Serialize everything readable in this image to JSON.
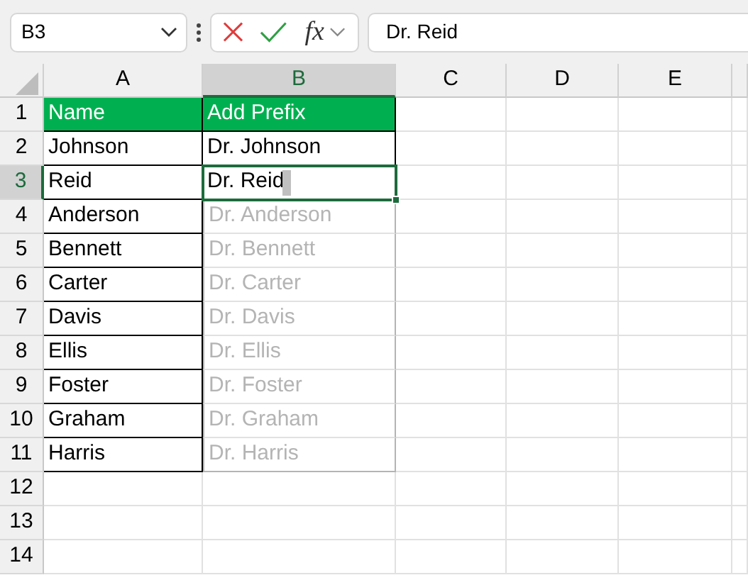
{
  "name_box": {
    "value": "B3"
  },
  "formula_bar": {
    "function_label": "fx",
    "value": "Dr. Reid"
  },
  "columns": [
    {
      "label": "A",
      "selected": false
    },
    {
      "label": "B",
      "selected": true
    },
    {
      "label": "C",
      "selected": false
    },
    {
      "label": "D",
      "selected": false
    },
    {
      "label": "E",
      "selected": false
    }
  ],
  "rows": [
    {
      "label": "1",
      "selected": false,
      "cells": [
        {
          "text": "Name",
          "kind": "header"
        },
        {
          "text": "Add Prefix",
          "kind": "header"
        }
      ]
    },
    {
      "label": "2",
      "selected": false,
      "cells": [
        {
          "text": "Johnson",
          "kind": "value"
        },
        {
          "text": "Dr. Johnson",
          "kind": "value"
        }
      ]
    },
    {
      "label": "3",
      "selected": true,
      "cells": [
        {
          "text": "Reid",
          "kind": "value"
        },
        {
          "text": "Dr. Reid",
          "kind": "active"
        }
      ]
    },
    {
      "label": "4",
      "selected": false,
      "cells": [
        {
          "text": "Anderson",
          "kind": "value"
        },
        {
          "text": "Dr. Anderson",
          "kind": "suggestion"
        }
      ]
    },
    {
      "label": "5",
      "selected": false,
      "cells": [
        {
          "text": "Bennett",
          "kind": "value"
        },
        {
          "text": "Dr. Bennett",
          "kind": "suggestion"
        }
      ]
    },
    {
      "label": "6",
      "selected": false,
      "cells": [
        {
          "text": "Carter",
          "kind": "value"
        },
        {
          "text": "Dr. Carter",
          "kind": "suggestion"
        }
      ]
    },
    {
      "label": "7",
      "selected": false,
      "cells": [
        {
          "text": "Davis",
          "kind": "value"
        },
        {
          "text": "Dr. Davis",
          "kind": "suggestion"
        }
      ]
    },
    {
      "label": "8",
      "selected": false,
      "cells": [
        {
          "text": "Ellis",
          "kind": "value"
        },
        {
          "text": "Dr. Ellis",
          "kind": "suggestion"
        }
      ]
    },
    {
      "label": "9",
      "selected": false,
      "cells": [
        {
          "text": "Foster",
          "kind": "value"
        },
        {
          "text": "Dr. Foster",
          "kind": "suggestion"
        }
      ]
    },
    {
      "label": "10",
      "selected": false,
      "cells": [
        {
          "text": "Graham",
          "kind": "value"
        },
        {
          "text": "Dr. Graham",
          "kind": "suggestion"
        }
      ]
    },
    {
      "label": "11",
      "selected": false,
      "cells": [
        {
          "text": "Harris",
          "kind": "value"
        },
        {
          "text": "Dr. Harris",
          "kind": "suggestion"
        }
      ]
    },
    {
      "label": "12",
      "selected": false
    },
    {
      "label": "13",
      "selected": false
    },
    {
      "label": "14",
      "selected": false
    }
  ]
}
